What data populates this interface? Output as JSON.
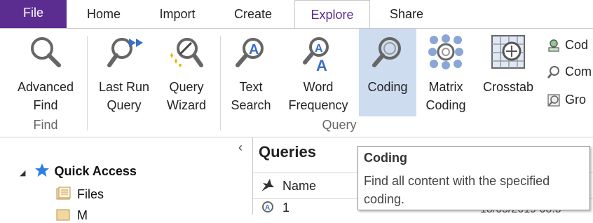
{
  "tabs": [
    {
      "id": "file",
      "label": "File"
    },
    {
      "id": "home",
      "label": "Home"
    },
    {
      "id": "import",
      "label": "Import"
    },
    {
      "id": "create",
      "label": "Create"
    },
    {
      "id": "explore",
      "label": "Explore",
      "active": true
    },
    {
      "id": "share",
      "label": "Share"
    }
  ],
  "ribbon": {
    "advanced_find": {
      "line1": "Advanced",
      "line2": "Find",
      "icon": "magnifier-icon"
    },
    "last_run_query": {
      "line1": "Last Run",
      "line2": "Query",
      "icon": "last-run-query-icon"
    },
    "query_wizard": {
      "line1": "Query",
      "line2": "Wizard",
      "icon": "query-wizard-icon"
    },
    "text_search": {
      "line1": "Text",
      "line2": "Search",
      "icon": "text-search-icon"
    },
    "word_frequency": {
      "line1": "Word",
      "line2": "Frequency",
      "icon": "word-frequency-icon"
    },
    "coding": {
      "line1": "Coding",
      "icon": "coding-query-icon",
      "selected": true
    },
    "matrix_coding": {
      "line1": "Matrix",
      "line2": "Coding",
      "icon": "matrix-coding-icon"
    },
    "crosstab": {
      "line1": "Crosstab",
      "icon": "crosstab-icon"
    },
    "small_buttons": [
      {
        "label": "Cod",
        "icon": "coding-comparison-icon"
      },
      {
        "label": "Com",
        "icon": "compound-query-icon"
      },
      {
        "label": "Gro",
        "icon": "group-query-icon"
      }
    ],
    "groups": {
      "find": "Find",
      "query": "Query"
    }
  },
  "nav": {
    "collapse_glyph": "‹",
    "quick_access": {
      "label": "Quick Access",
      "expander": "◢"
    },
    "items": [
      {
        "label": "Files",
        "icon": "files-icon"
      },
      {
        "label": "M",
        "icon": "memos-icon"
      }
    ]
  },
  "list": {
    "title": "Queries",
    "column_name": "Name",
    "row1_value": "1",
    "row1_date": "18/05/2019 08:5"
  },
  "tooltip": {
    "title": "Coding",
    "body": "Find all content with the specified coding."
  },
  "colors": {
    "file_tab": "#5c2d91",
    "selected_button": "#cddcef",
    "accent": "#5c2d91"
  }
}
